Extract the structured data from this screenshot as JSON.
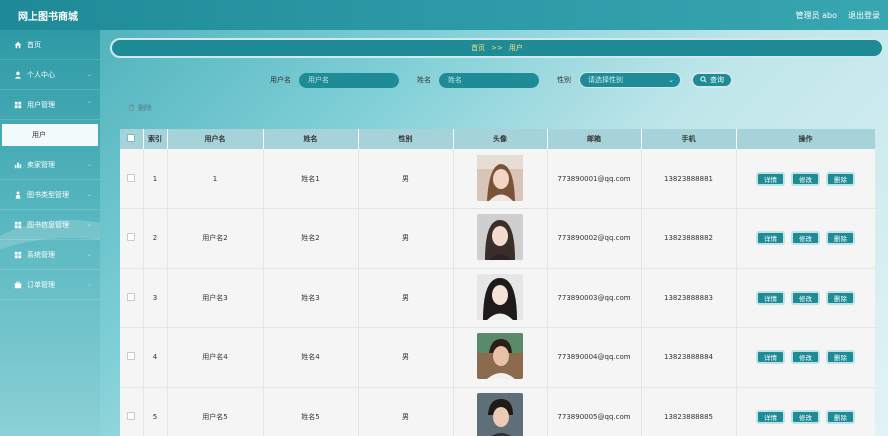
{
  "header": {
    "title": "网上图书商城",
    "admin_label": "管理员 abo",
    "logout_label": "退出登录"
  },
  "sidebar": {
    "items": [
      {
        "label": "首页",
        "icon": "home-icon"
      },
      {
        "label": "个人中心",
        "icon": "user-icon"
      },
      {
        "label": "用户管理",
        "icon": "grid-icon"
      },
      {
        "label": "卖家管理",
        "icon": "chart-icon"
      },
      {
        "label": "图书类型管理",
        "icon": "person-icon"
      },
      {
        "label": "图书信息管理",
        "icon": "grid-icon"
      },
      {
        "label": "系统管理",
        "icon": "grid-icon"
      },
      {
        "label": "订单管理",
        "icon": "briefcase-icon"
      }
    ],
    "subitem": "用户"
  },
  "breadcrumb": {
    "home": "首页",
    "separator": ">>",
    "current": "用户"
  },
  "search": {
    "username_label": "用户名",
    "username_placeholder": "用户名",
    "name_label": "姓名",
    "name_placeholder": "姓名",
    "gender_label": "性别",
    "gender_placeholder": "请选择性别",
    "query_label": "查询"
  },
  "actions": {
    "delete_label": "删除"
  },
  "table": {
    "columns": [
      "索引",
      "用户名",
      "姓名",
      "性别",
      "头像",
      "邮箱",
      "手机",
      "操作"
    ],
    "rows": [
      {
        "index": "1",
        "username": "1",
        "name": "姓名1",
        "gender": "男",
        "email": "773890001@qq.com",
        "phone": "13823888881"
      },
      {
        "index": "2",
        "username": "用户名2",
        "name": "姓名2",
        "gender": "男",
        "email": "773890002@qq.com",
        "phone": "13823888882"
      },
      {
        "index": "3",
        "username": "用户名3",
        "name": "姓名3",
        "gender": "男",
        "email": "773890003@qq.com",
        "phone": "13823888883"
      },
      {
        "index": "4",
        "username": "用户名4",
        "name": "姓名4",
        "gender": "男",
        "email": "773890004@qq.com",
        "phone": "13823888884"
      },
      {
        "index": "5",
        "username": "用户名5",
        "name": "姓名5",
        "gender": "男",
        "email": "773890005@qq.com",
        "phone": "13823888885"
      }
    ],
    "op_labels": {
      "detail": "详情",
      "edit": "修改",
      "delete": "删除"
    }
  },
  "colors": {
    "primary": "#1f8b97",
    "header_bg": "#2c9aa6",
    "table_header": "#a5d3d9",
    "breadcrumb_text": "#f6e07a"
  }
}
